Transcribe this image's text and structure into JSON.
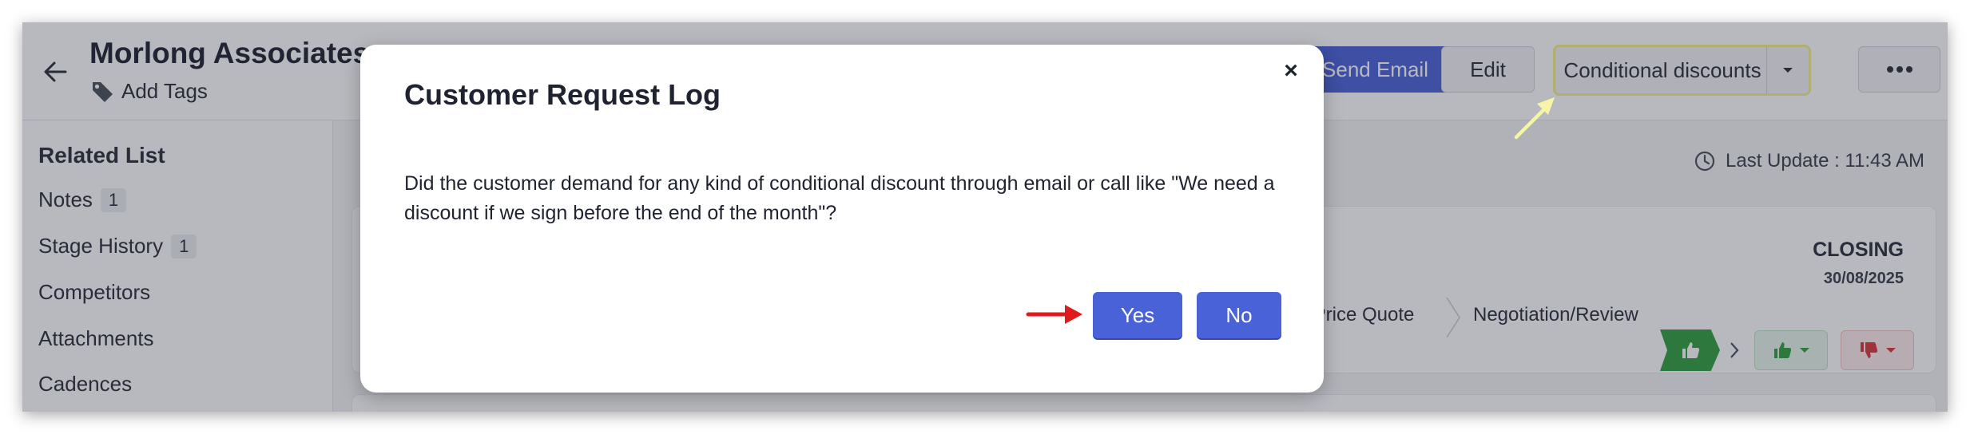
{
  "header": {
    "title": "Morlong Associates",
    "add_tags_label": "Add Tags",
    "send_email_label": "Send Email",
    "edit_label": "Edit",
    "conditional_discounts_label": "Conditional discounts"
  },
  "sidebar": {
    "title": "Related List",
    "items": [
      {
        "label": "Notes",
        "count": "1"
      },
      {
        "label": "Stage History",
        "count": "1"
      },
      {
        "label": "Competitors"
      },
      {
        "label": "Attachments"
      },
      {
        "label": "Cadences"
      }
    ]
  },
  "main": {
    "last_update_label": "Last Update : 11:43 AM",
    "closing_label": "CLOSING",
    "closing_date": "30/08/2025",
    "stages": [
      {
        "label": "/Price Quote"
      },
      {
        "label": "Negotiation/Review"
      }
    ]
  },
  "modal": {
    "title": "Customer Request Log",
    "body": "Did the customer demand for any kind of conditional discount through email or call like \"We need a discount if we sign before the end of the month\"?",
    "yes_label": "Yes",
    "no_label": "No",
    "close_glyph": "×"
  },
  "colors": {
    "primary": "#4a62d8",
    "highlight_border": "#f3f08a",
    "stage_active": "#2f9e3f",
    "won_icon": "#2f9e3f",
    "lost_icon": "#d93a3a",
    "annotation_arrow_red": "#e01b1b",
    "annotation_arrow_yellow": "#f6f4a6"
  },
  "icons": {
    "back": "arrow-left-icon",
    "tag": "tag-icon",
    "caret": "chevron-down-icon",
    "more": "more-horizontal-icon",
    "clock": "clock-icon",
    "thumbs_up": "thumbs-up-icon",
    "thumbs_down": "thumbs-down-icon",
    "next": "chevron-right-icon"
  }
}
